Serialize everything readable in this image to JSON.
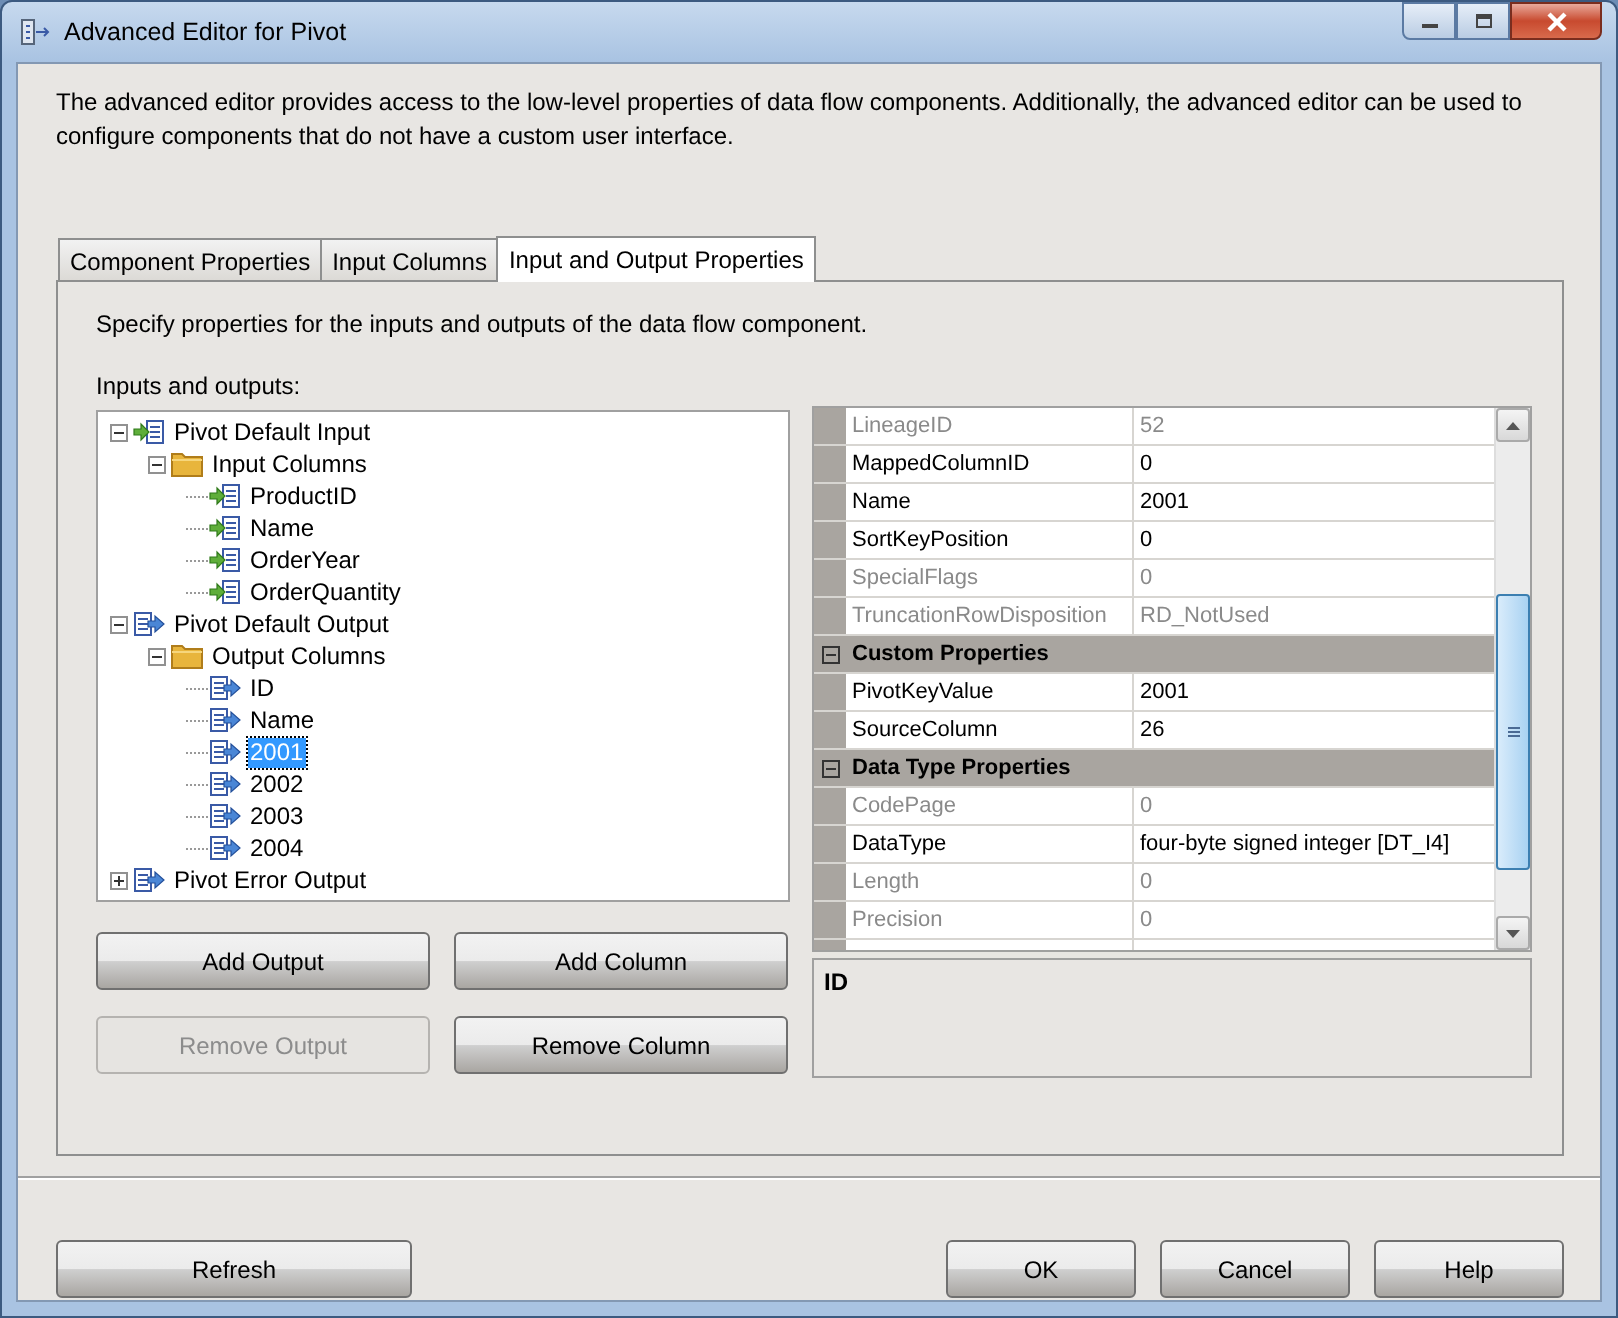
{
  "window": {
    "title": "Advanced Editor for Pivot"
  },
  "description": "The advanced editor provides access to the low-level properties of data flow components. Additionally, the advanced editor can be used to configure components that do not have a custom user interface.",
  "tabs": [
    {
      "label": "Component Properties",
      "selected": false
    },
    {
      "label": "Input Columns",
      "selected": false
    },
    {
      "label": "Input and Output Properties",
      "selected": true
    }
  ],
  "panel_hint": "Specify properties for the inputs and outputs of the data flow component.",
  "tree_label": "Inputs and outputs:",
  "tree": [
    {
      "label": "Pivot Default Input",
      "kind": "input",
      "expanded": true,
      "selected": false,
      "children": [
        {
          "label": "Input Columns",
          "kind": "folder",
          "expanded": true,
          "selected": false,
          "children": [
            {
              "label": "ProductID",
              "kind": "input",
              "selected": false
            },
            {
              "label": "Name",
              "kind": "input",
              "selected": false
            },
            {
              "label": "OrderYear",
              "kind": "input",
              "selected": false
            },
            {
              "label": "OrderQuantity",
              "kind": "input",
              "selected": false
            }
          ]
        }
      ]
    },
    {
      "label": "Pivot Default Output",
      "kind": "output",
      "expanded": true,
      "selected": false,
      "children": [
        {
          "label": "Output Columns",
          "kind": "folder",
          "expanded": true,
          "selected": false,
          "children": [
            {
              "label": "ID",
              "kind": "output",
              "selected": false
            },
            {
              "label": "Name",
              "kind": "output",
              "selected": false
            },
            {
              "label": "2001",
              "kind": "output",
              "selected": true
            },
            {
              "label": "2002",
              "kind": "output",
              "selected": false
            },
            {
              "label": "2003",
              "kind": "output",
              "selected": false
            },
            {
              "label": "2004",
              "kind": "output",
              "selected": false
            }
          ]
        }
      ]
    },
    {
      "label": "Pivot Error Output",
      "kind": "output",
      "expanded": false,
      "selected": false
    }
  ],
  "tree_buttons": [
    {
      "label": "Add Output",
      "disabled": false
    },
    {
      "label": "Add Column",
      "disabled": false
    },
    {
      "label": "Remove Output",
      "disabled": true
    },
    {
      "label": "Remove Column",
      "disabled": false
    }
  ],
  "properties": [
    {
      "kind": "row",
      "name": "LineageID",
      "value": "52",
      "disabled": true
    },
    {
      "kind": "row",
      "name": "MappedColumnID",
      "value": "0",
      "disabled": false
    },
    {
      "kind": "row",
      "name": "Name",
      "value": "2001",
      "disabled": false
    },
    {
      "kind": "row",
      "name": "SortKeyPosition",
      "value": "0",
      "disabled": false
    },
    {
      "kind": "row",
      "name": "SpecialFlags",
      "value": "0",
      "disabled": true
    },
    {
      "kind": "row",
      "name": "TruncationRowDisposition",
      "value": "RD_NotUsed",
      "disabled": true
    },
    {
      "kind": "category",
      "name": "Custom Properties",
      "expanded": true
    },
    {
      "kind": "row",
      "name": "PivotKeyValue",
      "value": "2001",
      "disabled": false
    },
    {
      "kind": "row",
      "name": "SourceColumn",
      "value": "26",
      "disabled": false
    },
    {
      "kind": "category",
      "name": "Data Type Properties",
      "expanded": true
    },
    {
      "kind": "row",
      "name": "CodePage",
      "value": "0",
      "disabled": true
    },
    {
      "kind": "row",
      "name": "DataType",
      "value": "four-byte signed integer [DT_I4]",
      "disabled": false
    },
    {
      "kind": "row",
      "name": "Length",
      "value": "0",
      "disabled": true
    },
    {
      "kind": "row",
      "name": "Precision",
      "value": "0",
      "disabled": true
    }
  ],
  "property_description": "ID",
  "footer_buttons": [
    {
      "label": "Refresh"
    },
    {
      "label": "OK"
    },
    {
      "label": "Cancel"
    },
    {
      "label": "Help"
    }
  ]
}
